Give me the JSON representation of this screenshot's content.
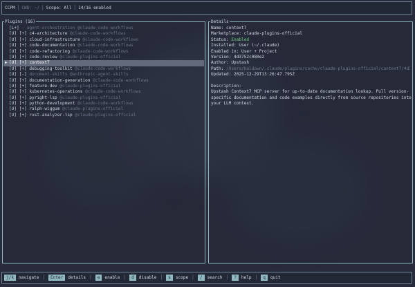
{
  "topbar": {
    "app": "CCPM",
    "cwd_label": "CWD: ~/",
    "scope": "Scope: All",
    "enabled_count": "14/16 enabled"
  },
  "plugins": {
    "title": "Plugins (16)",
    "items": [
      {
        "cursor": "",
        "status": "[L+]",
        "name": "- agent-orchestration",
        "market": "@claude-code-workflows",
        "disabled": true,
        "selected": false
      },
      {
        "cursor": "",
        "status": "[U] [+]",
        "name": "c4-architecture",
        "market": "@claude-code-workflows",
        "disabled": false,
        "selected": false
      },
      {
        "cursor": "",
        "status": "[U] [+]",
        "name": "cloud-infrastructure",
        "market": "@claude-code-workflows",
        "disabled": false,
        "selected": false
      },
      {
        "cursor": "",
        "status": "[U] [+]",
        "name": "code-documentation",
        "market": "@claude-code-workflows",
        "disabled": false,
        "selected": false
      },
      {
        "cursor": "",
        "status": "[U] [+]",
        "name": "code-refactoring",
        "market": "@claude-code-workflows",
        "disabled": false,
        "selected": false
      },
      {
        "cursor": "",
        "status": "[U] [+]",
        "name": "code-review",
        "market": "@claude-plugins-official",
        "disabled": false,
        "selected": false
      },
      {
        "cursor": "▶",
        "status": "[U] [+]",
        "name": "context7",
        "market": "",
        "disabled": false,
        "selected": true
      },
      {
        "cursor": "",
        "status": "[U] [+]",
        "name": "debugging-toolkit",
        "market": "@claude-code-workflows",
        "disabled": false,
        "selected": false
      },
      {
        "cursor": "",
        "status": "[U] [-]",
        "name": "document-skills",
        "market": "@anthropic-agent-skills",
        "disabled": true,
        "selected": false
      },
      {
        "cursor": "",
        "status": "[U] [+]",
        "name": "documentation-generation",
        "market": "@claude-code-workflows",
        "disabled": false,
        "selected": false
      },
      {
        "cursor": "",
        "status": "[U] [+]",
        "name": "feature-dev",
        "market": "@claude-plugins-official",
        "disabled": false,
        "selected": false
      },
      {
        "cursor": "",
        "status": "[U] [+]",
        "name": "kubernetes-operations",
        "market": "@claude-code-workflows",
        "disabled": false,
        "selected": false
      },
      {
        "cursor": "",
        "status": "[U] [+]",
        "name": "pyright-lsp",
        "market": "@claude-plugins-official",
        "disabled": false,
        "selected": false
      },
      {
        "cursor": "",
        "status": "[U] [+]",
        "name": "python-development",
        "market": "@claude-code-workflows",
        "disabled": false,
        "selected": false
      },
      {
        "cursor": "",
        "status": "[U] [+]",
        "name": "ralph-wiggum",
        "market": "@claude-plugins-official",
        "disabled": false,
        "selected": false
      },
      {
        "cursor": "",
        "status": "[U] [+]",
        "name": "rust-analyzer-lsp",
        "market": "@claude-plugins-official",
        "disabled": false,
        "selected": false
      }
    ]
  },
  "details": {
    "title": "Details",
    "lines": [
      {
        "key": "Name: ",
        "value": "context7",
        "style": ""
      },
      {
        "key": "Marketplace: ",
        "value": "claude-plugins-official",
        "style": ""
      },
      {
        "key": "Status: ",
        "value": "Enabled",
        "style": "green"
      },
      {
        "key": "Installed: ",
        "value": "User (~/.claude)",
        "style": ""
      },
      {
        "key": "Enabled in: ",
        "value": "User + Project",
        "style": ""
      },
      {
        "key": "Version: ",
        "value": "4d3752c080e2",
        "style": ""
      },
      {
        "key": "Author: ",
        "value": "Upstash",
        "style": ""
      },
      {
        "key": "Path: ",
        "value": "/Users/kaldown/.claude/plugins/cache/claude-plugins-official/context7/4d3752c080e2",
        "style": "dim"
      },
      {
        "key": "Updated: ",
        "value": "2025-12-29T13:26:47.795Z",
        "style": ""
      }
    ],
    "description_label": "Description:",
    "description": "Upstash Context7 MCP server for up-to-date documentation lookup. Pull version-specific documentation and code examples directly from source repositories into your LLM context."
  },
  "help": [
    {
      "key": "j/k",
      "label": "navigate"
    },
    {
      "key": "Enter",
      "label": "details"
    },
    {
      "key": "e",
      "label": "enable"
    },
    {
      "key": "d",
      "label": "disable"
    },
    {
      "key": "s",
      "label": "scope"
    },
    {
      "key": "/",
      "label": "search"
    },
    {
      "key": "?",
      "label": "help"
    },
    {
      "key": "q",
      "label": "quit"
    }
  ],
  "colors": {
    "background": "#272b3b",
    "border": "#8db7bd",
    "key_badge": "#8fb8c0",
    "selection": "#636a7c",
    "enabled": "#6fd27f"
  }
}
